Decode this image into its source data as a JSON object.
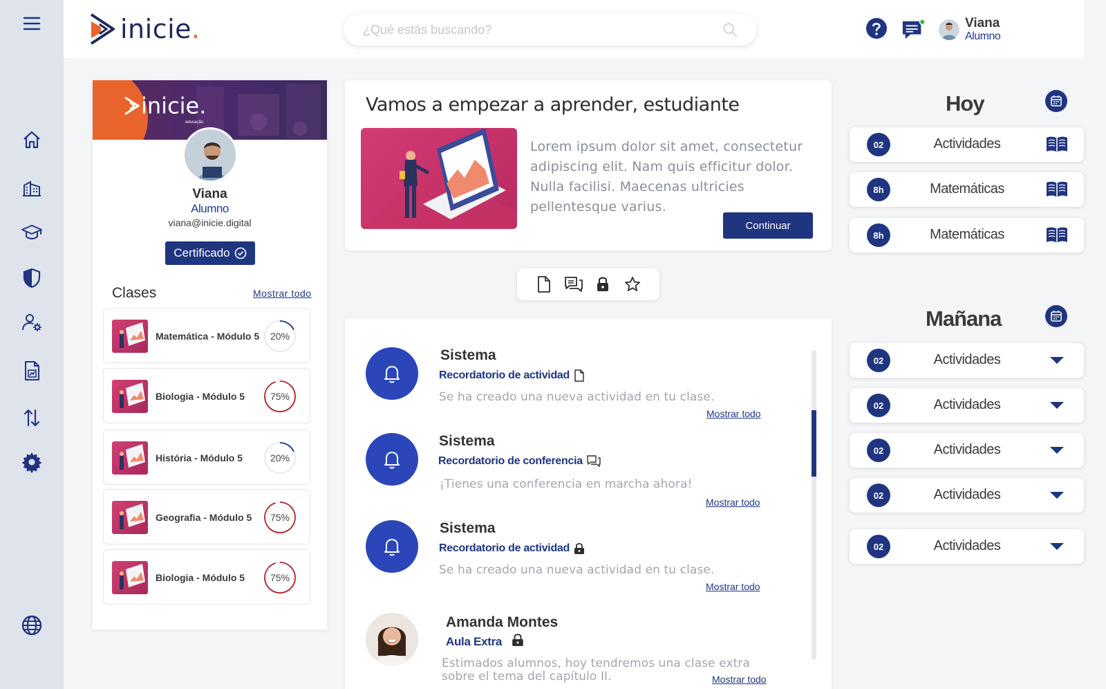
{
  "brand": {
    "name": "inicie",
    "dot": ".",
    "banner_sub": "educação"
  },
  "search": {
    "placeholder": "¿Qué estás buscando?"
  },
  "user": {
    "name": "Viana",
    "role": "Alumno"
  },
  "profile": {
    "name": "Viana",
    "role": "Alumno",
    "email": "viana@inicie.digital",
    "certificate_label": "Certificado"
  },
  "clases": {
    "title": "Clases",
    "show_all": "Mostrar todo",
    "items": [
      {
        "label": "Matemática - Módulo 5",
        "progress": 20,
        "progress_label": "20%"
      },
      {
        "label": "Biologia - Módulo 5",
        "progress": 75,
        "progress_label": "75%"
      },
      {
        "label": "História - Módulo 5",
        "progress": 20,
        "progress_label": "20%"
      },
      {
        "label": "Geografia - Módulo 5",
        "progress": 75,
        "progress_label": "75%"
      },
      {
        "label": "Biologia - Módulo 5",
        "progress": 75,
        "progress_label": "75%"
      }
    ]
  },
  "welcome": {
    "title": "Vamos a empezar a aprender, estudiante",
    "text": "Lorem ipsum dolor sit amet, consectetur adipiscing elit. Nam quis efficitur dolor. Nulla facilisi. Maecenas ultricies pellentesque varius.",
    "button": "Continuar"
  },
  "notifications": {
    "show_all": "Mostrar todo",
    "items": [
      {
        "title": "Sistema",
        "subtitle": "Recordatorio de actividad",
        "icon": "document-icon",
        "message": "Se ha creado una nueva actividad en tu clase."
      },
      {
        "title": "Sistema",
        "subtitle": "Recordatorio de conferencia",
        "icon": "chat-icon",
        "message": "¡Tienes una conferencia en marcha ahora!"
      },
      {
        "title": "Sistema",
        "subtitle": "Recordatorio de actividad",
        "icon": "lock-icon",
        "message": "Se ha creado una nueva actividad en tu clase."
      },
      {
        "title": "Amanda Montes",
        "subtitle": "Aula Extra",
        "icon": "lock-icon",
        "message_line1": "Estimados alumnos, hoy tendremos una clase extra",
        "message_line2": "sobre el tema del capítulo II."
      }
    ]
  },
  "hoy": {
    "title": "Hoy",
    "items": [
      {
        "badge": "02",
        "label": "Actividades"
      },
      {
        "badge": "8h",
        "label": "Matemáticas"
      },
      {
        "badge": "8h",
        "label": "Matemáticas"
      }
    ]
  },
  "manana": {
    "title": "Mañana",
    "items": [
      {
        "badge": "02",
        "label": "Actividades"
      },
      {
        "badge": "02",
        "label": "Actividades"
      },
      {
        "badge": "02",
        "label": "Actividades"
      },
      {
        "badge": "02",
        "label": "Actividades"
      },
      {
        "badge": "02",
        "label": "Actividades"
      }
    ]
  },
  "colors": {
    "primary": "#1f3580",
    "accent": "#e8642c",
    "bell": "#2b46b8",
    "progress_high": "#b0262e"
  }
}
